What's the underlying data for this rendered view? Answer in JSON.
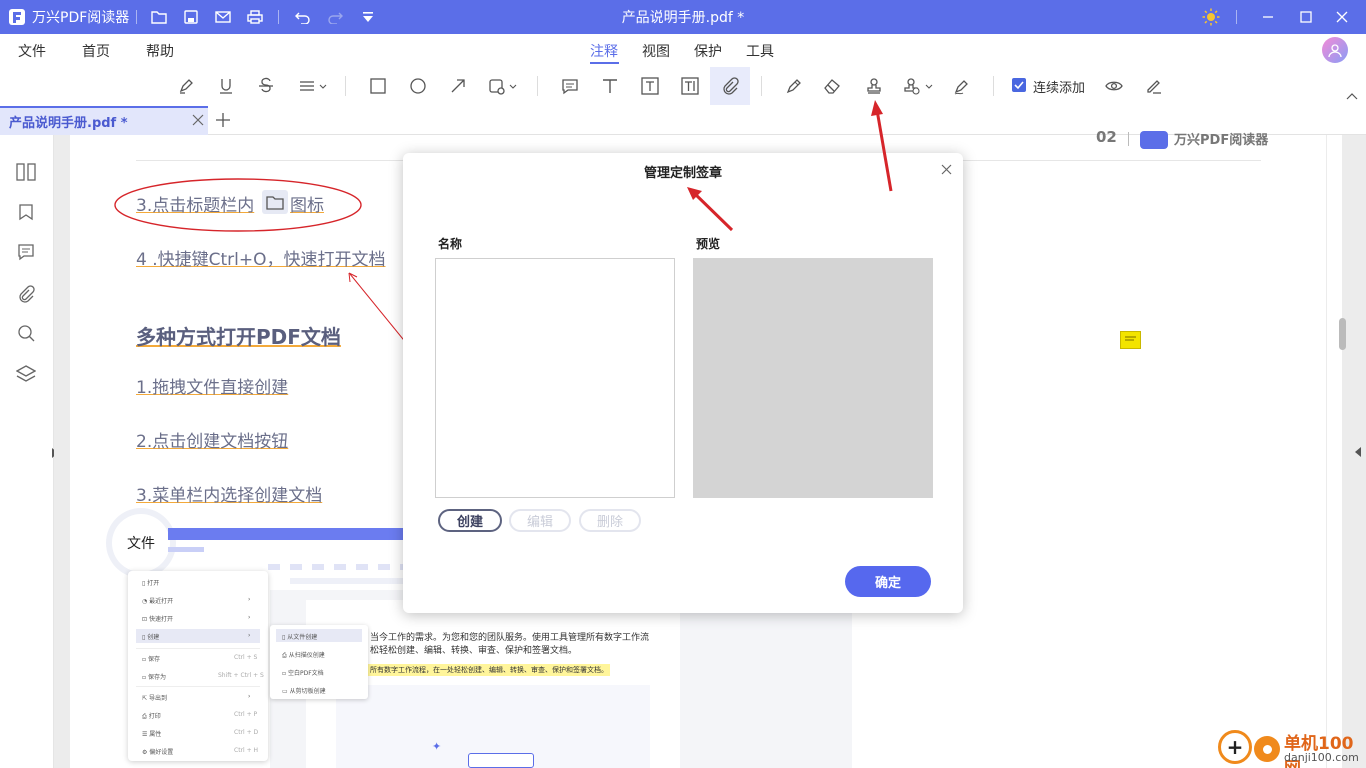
{
  "app": {
    "name": "万兴PDF阅读器",
    "doc_title": "产品说明手册.pdf *"
  },
  "colors": {
    "accent": "#5b6ee8",
    "arrow": "#d6252a",
    "annotation": "#f3e400"
  },
  "menu": {
    "file": "文件",
    "home": "首页",
    "help": "帮助"
  },
  "top_tabs": {
    "annotate": "注释",
    "view": "视图",
    "protect": "保护",
    "tools": "工具"
  },
  "toolbar": {
    "continuous_add": "连续添加",
    "continuous_checked": true
  },
  "doc_tab": {
    "label": "产品说明手册.pdf *"
  },
  "document": {
    "header_page": "02",
    "header_brand": "万兴PDF阅读器",
    "line1": "3.点击标题栏内",
    "line1_suffix": "图标",
    "line2": "4 .快捷键Ctrl+O，快速打开文档",
    "heading": "多种方式打开PDF文档",
    "item1": "1.拖拽文件直接创建",
    "item2": "2.点击创建文档按钮",
    "item3": "3.菜单栏内选择创建文档",
    "file_bubble": "文件",
    "mini_menu": [
      "打开",
      "最近打开",
      "快速打开",
      "创建",
      "保存",
      "保存为",
      "导出到",
      "打印",
      "属性",
      "偏好设置"
    ],
    "mini_shortcuts": [
      "Ctrl + S",
      "Shift + Ctrl + S",
      "Ctrl + P",
      "Ctrl + D",
      "Ctrl + H"
    ],
    "mini_submenu": [
      "从文件创建",
      "从扫描仪创建",
      "空白PDF文档",
      "从剪切板创建"
    ],
    "body_text1": "当今工作的需求。为您和您的团队服务。使用工具管理所有数字工作流",
    "body_text2": "松轻松创建、编辑、转换、审查、保护和签署文档。",
    "body_highlight": "所有数字工作流程，在一处轻松创建、编辑、转换、审查、保护和签署文档。"
  },
  "dialog": {
    "title": "管理定制签章",
    "name_label": "名称",
    "preview_label": "预览",
    "create": "创建",
    "edit": "编辑",
    "delete": "删除",
    "ok": "确定"
  },
  "watermark": {
    "site": "单机100网",
    "url": "danji100.com"
  }
}
